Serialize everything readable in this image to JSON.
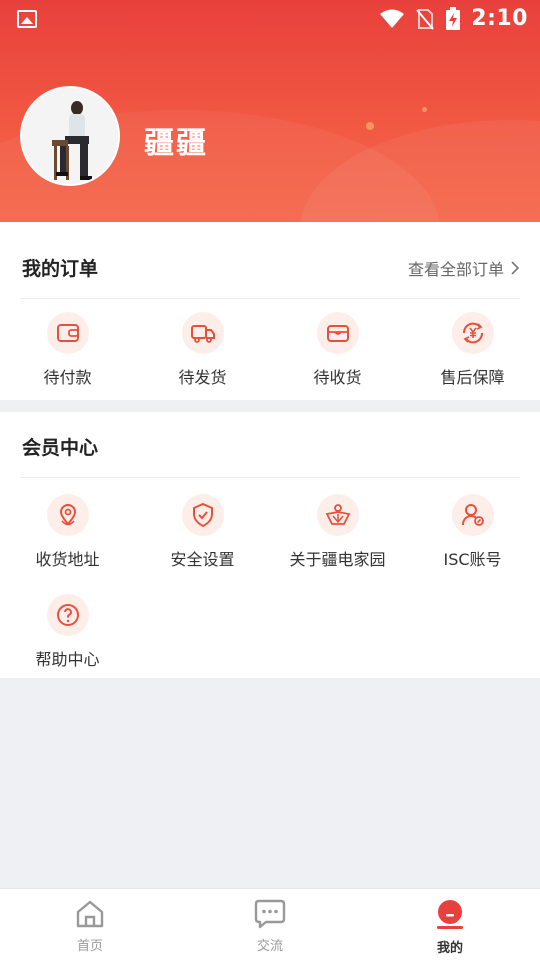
{
  "status_bar": {
    "time": "2:10"
  },
  "profile": {
    "username": "疆疆"
  },
  "orders": {
    "title": "我的订单",
    "view_all": "查看全部订单",
    "items": [
      {
        "label": "待付款",
        "icon": "wallet-icon"
      },
      {
        "label": "待发货",
        "icon": "truck-icon"
      },
      {
        "label": "待收货",
        "icon": "box-icon"
      },
      {
        "label": "售后保障",
        "icon": "yen-refund-icon"
      }
    ]
  },
  "member": {
    "title": "会员中心",
    "items": [
      {
        "label": "收货地址",
        "icon": "location-icon"
      },
      {
        "label": "安全设置",
        "icon": "shield-check-icon"
      },
      {
        "label": "关于疆电家园",
        "icon": "about-icon"
      },
      {
        "label": "ISC账号",
        "icon": "user-account-icon"
      },
      {
        "label": "帮助中心",
        "icon": "help-icon"
      }
    ]
  },
  "bottom_nav": {
    "items": [
      {
        "label": "首页",
        "icon": "home-icon"
      },
      {
        "label": "交流",
        "icon": "chat-icon"
      },
      {
        "label": "我的",
        "icon": "profile-icon"
      }
    ],
    "active": "我的"
  },
  "colors": {
    "accent": "#e8403c",
    "icon_bg": "#fdeeea",
    "page_bg": "#eef0f3"
  }
}
